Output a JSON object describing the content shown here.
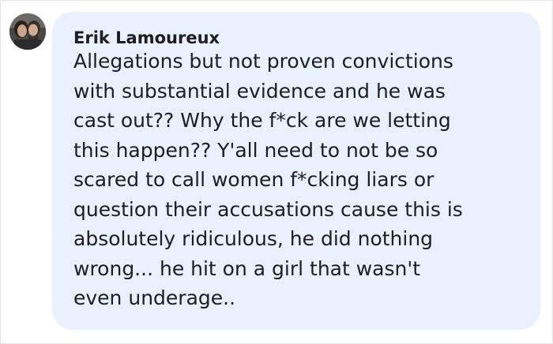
{
  "comment": {
    "author": "Erik Lamoureux",
    "lines": [
      "Allegations but not proven convictions",
      "with substantial evidence and he was",
      "cast out?? Why the f*ck are we letting",
      "this happen?? Y'all need to not be so",
      "scared to call women f*cking liars or",
      "question their accusations cause this is",
      "absolutely ridiculous, he did nothing",
      "wrong... he hit on a girl that wasn't",
      "even underage.."
    ]
  },
  "colors": {
    "bubble_background": "#e8f1fd",
    "text": "#1c1e21"
  }
}
